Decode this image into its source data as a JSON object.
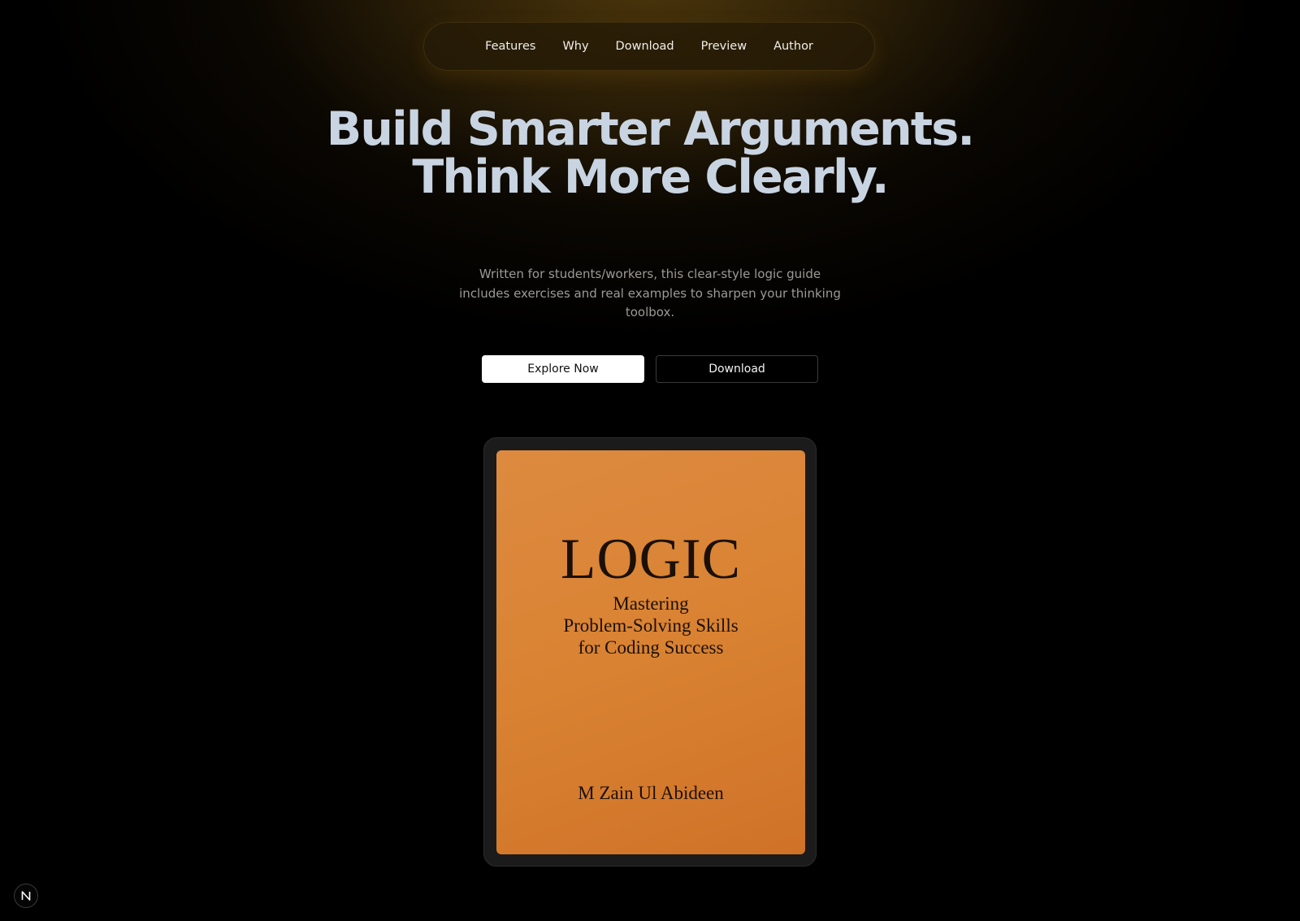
{
  "nav": {
    "links": [
      {
        "label": "Features"
      },
      {
        "label": "Why"
      },
      {
        "label": "Download"
      },
      {
        "label": "Preview"
      },
      {
        "label": "Author"
      }
    ]
  },
  "hero": {
    "headline": "Build Smarter Arguments. Think More Clearly.",
    "subtitle": "Written for students/workers, this clear-style logic guide includes exercises and real examples to sharpen your thinking toolbox.",
    "primary_button": "Explore Now",
    "secondary_button": "Download"
  },
  "book": {
    "title": "LOGIC",
    "subtitle_lines": [
      "Mastering",
      "Problem-Solving Skills",
      "for Coding Success"
    ],
    "author": "M Zain Ul Abideen",
    "cover_color": "#d9823a"
  },
  "badge": {
    "icon": "n-logo-icon"
  },
  "colors": {
    "background": "#000000",
    "glow": "#5c420e",
    "headline": "#c9d4e2"
  }
}
